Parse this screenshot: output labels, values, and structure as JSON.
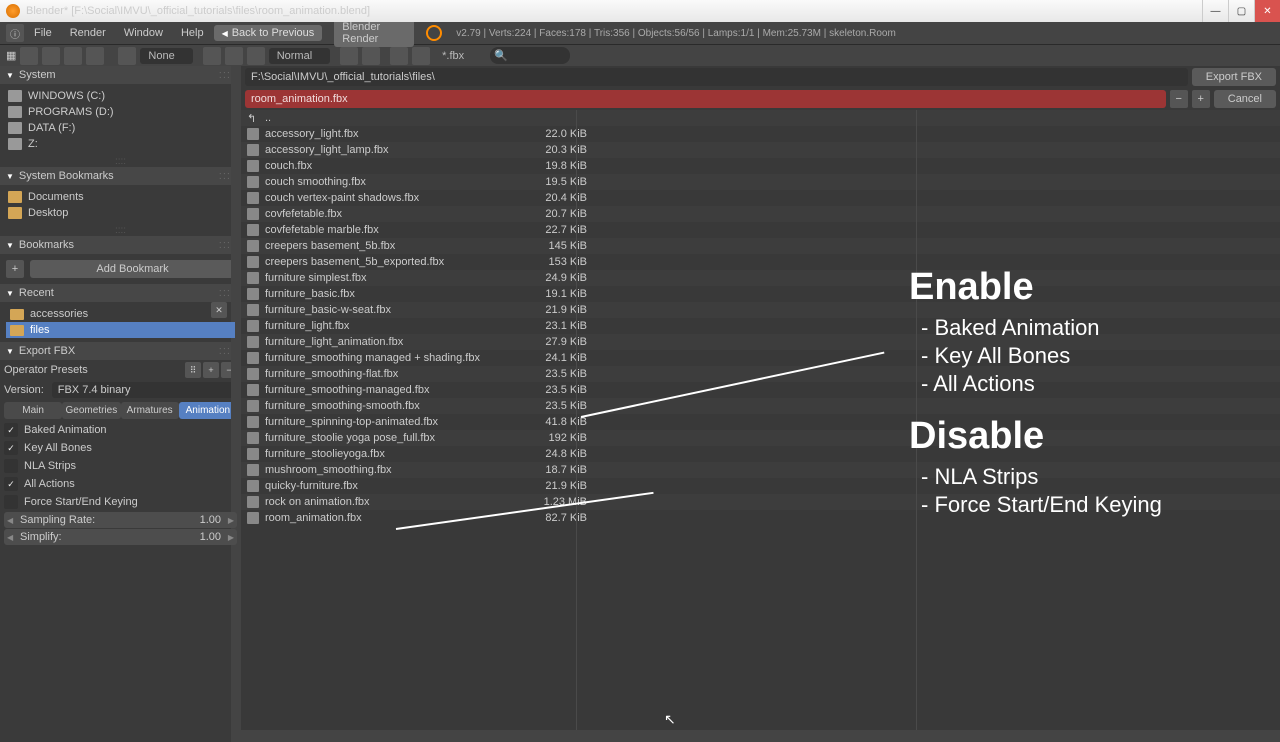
{
  "title": "Blender* [F:\\Social\\IMVU\\_official_tutorials\\files\\room_animation.blend]",
  "menu": {
    "file": "File",
    "render": "Render",
    "window": "Window",
    "help": "Help",
    "back": "Back to Previous",
    "engine": "Blender Render"
  },
  "stats": "v2.79 | Verts:224 | Faces:178 | Tris:356 | Objects:56/56 | Lamps:1/1 | Mem:25.73M | skeleton.Room",
  "tb2": {
    "none": "None",
    "normal": "Normal",
    "filter": "*.fbx"
  },
  "path": "F:\\Social\\IMVU\\_official_tutorials\\files\\",
  "filename": "room_animation.fbx",
  "export_btn": "Export FBX",
  "cancel_btn": "Cancel",
  "sidebar": {
    "system": "System",
    "drives": [
      "WINDOWS (C:)",
      "PROGRAMS (D:)",
      "DATA (F:)",
      "Z:"
    ],
    "sys_bm": "System Bookmarks",
    "sys_bm_items": [
      "Documents",
      "Desktop"
    ],
    "bookmarks": "Bookmarks",
    "add_bm": "Add Bookmark",
    "recent": "Recent",
    "recent_items": [
      "accessories",
      "files"
    ],
    "export_hdr": "Export FBX",
    "op_presets": "Operator Presets",
    "version_lbl": "Version:",
    "version_val": "FBX 7.4 binary",
    "tabs": [
      "Main",
      "Geometries",
      "Armatures",
      "Animation"
    ],
    "checks": [
      {
        "label": "Baked Animation",
        "on": true
      },
      {
        "label": "Key All Bones",
        "on": true
      },
      {
        "label": "NLA Strips",
        "on": false
      },
      {
        "label": "All Actions",
        "on": true
      },
      {
        "label": "Force Start/End Keying",
        "on": false
      }
    ],
    "sampling": {
      "label": "Sampling Rate:",
      "val": "1.00"
    },
    "simplify": {
      "label": "Simplify:",
      "val": "1.00"
    }
  },
  "files": [
    {
      "name": "..",
      "size": ""
    },
    {
      "name": "accessory_light.fbx",
      "size": "22.0 KiB"
    },
    {
      "name": "accessory_light_lamp.fbx",
      "size": "20.3 KiB"
    },
    {
      "name": "couch.fbx",
      "size": "19.8 KiB"
    },
    {
      "name": "couch smoothing.fbx",
      "size": "19.5 KiB"
    },
    {
      "name": "couch vertex-paint shadows.fbx",
      "size": "20.4 KiB"
    },
    {
      "name": "covfefetable.fbx",
      "size": "20.7 KiB"
    },
    {
      "name": "covfefetable marble.fbx",
      "size": "22.7 KiB"
    },
    {
      "name": "creepers basement_5b.fbx",
      "size": "145 KiB"
    },
    {
      "name": "creepers basement_5b_exported.fbx",
      "size": "153 KiB"
    },
    {
      "name": "furniture simplest.fbx",
      "size": "24.9 KiB"
    },
    {
      "name": "furniture_basic.fbx",
      "size": "19.1 KiB"
    },
    {
      "name": "furniture_basic-w-seat.fbx",
      "size": "21.9 KiB"
    },
    {
      "name": "furniture_light.fbx",
      "size": "23.1 KiB"
    },
    {
      "name": "furniture_light_animation.fbx",
      "size": "27.9 KiB"
    },
    {
      "name": "furniture_smoothing managed + shading.fbx",
      "size": "24.1 KiB"
    },
    {
      "name": "furniture_smoothing-flat.fbx",
      "size": "23.5 KiB"
    },
    {
      "name": "furniture_smoothing-managed.fbx",
      "size": "23.5 KiB"
    },
    {
      "name": "furniture_smoothing-smooth.fbx",
      "size": "23.5 KiB"
    },
    {
      "name": "furniture_spinning-top-animated.fbx",
      "size": "41.8 KiB"
    },
    {
      "name": "furniture_stoolie yoga pose_full.fbx",
      "size": "192 KiB"
    },
    {
      "name": "furniture_stoolieyoga.fbx",
      "size": "24.8 KiB"
    },
    {
      "name": "mushroom_smoothing.fbx",
      "size": "18.7 KiB"
    },
    {
      "name": "quicky-furniture.fbx",
      "size": "21.9 KiB"
    },
    {
      "name": "rock on animation.fbx",
      "size": "1.23 MiB"
    },
    {
      "name": "room_animation.fbx",
      "size": "82.7 KiB"
    }
  ],
  "overlay": {
    "enable": "Enable",
    "e1": "- Baked Animation",
    "e2": "- Key All Bones",
    "e3": "- All Actions",
    "disable": "Disable",
    "d1": "- NLA Strips",
    "d2": "- Force Start/End Keying"
  }
}
